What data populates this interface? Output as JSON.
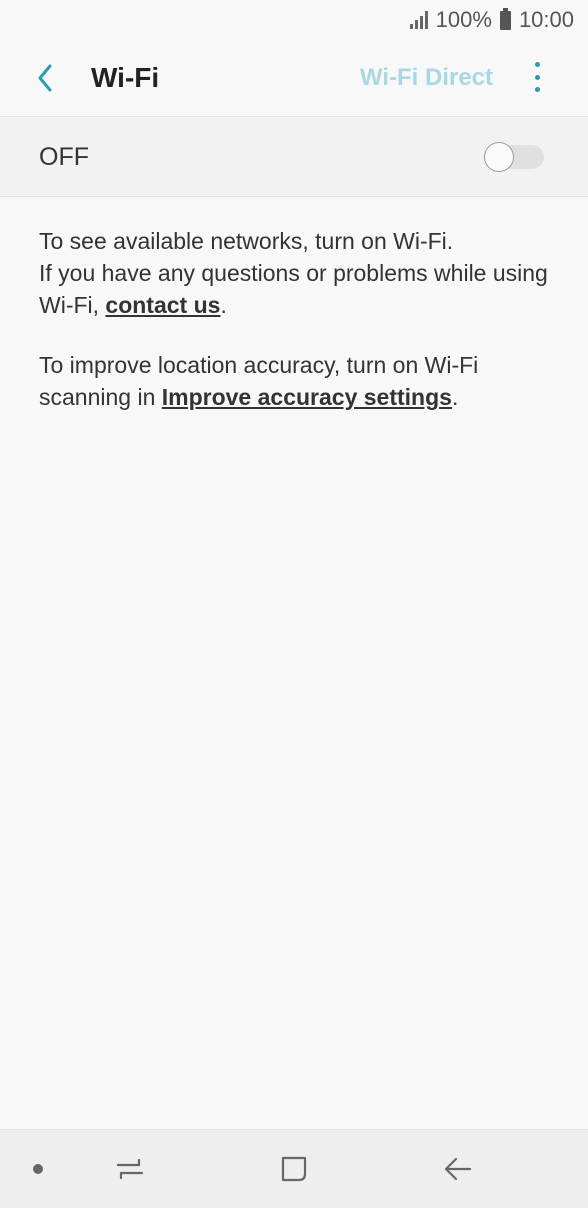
{
  "status_bar": {
    "battery_text": "100%",
    "time": "10:00",
    "icons": [
      "signal-icon",
      "battery-icon"
    ]
  },
  "app_bar": {
    "back_icon": "chevron-left-icon",
    "title": "Wi-Fi",
    "wifi_direct_label": "Wi-Fi Direct",
    "more_icon": "more-vertical-icon"
  },
  "wifi_toggle": {
    "label": "OFF",
    "on": false
  },
  "message": {
    "line1": "To see available networks, turn on Wi-Fi.",
    "line2_prefix": "If you have any questions or problems while using Wi-Fi, ",
    "contact_link": "contact us",
    "line2_suffix": ".",
    "line3_prefix": "To improve location accuracy, turn on Wi-Fi scanning in ",
    "accuracy_link": "Improve accuracy settings",
    "line3_suffix": "."
  },
  "nav_bar": {
    "items": [
      "dot-icon",
      "recent-apps-icon",
      "home-icon",
      "back-arrow-icon"
    ]
  },
  "colors": {
    "accent": "#2a9cb2",
    "wifi_direct_disabled": "#a9d8e4",
    "background": "#f8f8f8"
  }
}
